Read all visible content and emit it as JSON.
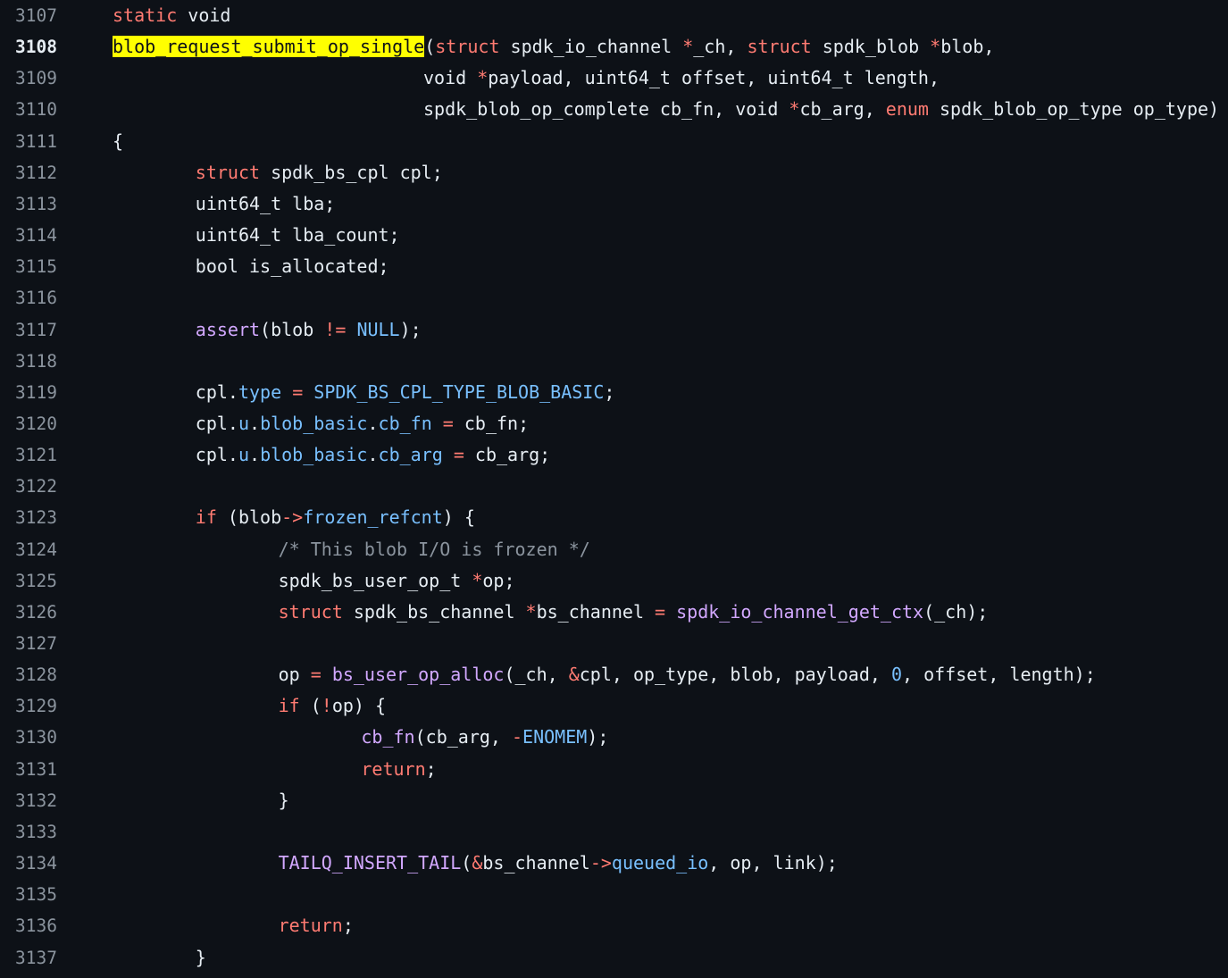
{
  "code_view": {
    "current_line": 3108,
    "colors": {
      "background": "#0d1117",
      "text": "#e6edf3",
      "keyword": "#ff7b72",
      "function": "#d2a8ff",
      "constant": "#79c0ff",
      "comment": "#8b949e",
      "line_number": "#8b949e",
      "highlight": "#ffff00"
    },
    "lines": [
      {
        "n": "3107",
        "indent": 0,
        "tokens": [
          [
            "k",
            "static"
          ],
          [
            "t",
            " void"
          ]
        ]
      },
      {
        "n": "3108",
        "indent": 0,
        "tokens": [
          [
            "h",
            "blob_request_submit_op_single"
          ],
          [
            "t",
            "("
          ],
          [
            "k",
            "struct"
          ],
          [
            "t",
            " spdk_io_channel "
          ],
          [
            "k",
            "*"
          ],
          [
            "t",
            "_ch, "
          ],
          [
            "k",
            "struct"
          ],
          [
            "t",
            " spdk_blob "
          ],
          [
            "k",
            "*"
          ],
          [
            "t",
            "blob,"
          ]
        ]
      },
      {
        "n": "3109",
        "indent": 30,
        "tokens": [
          [
            "t",
            "void "
          ],
          [
            "k",
            "*"
          ],
          [
            "t",
            "payload, uint64_t offset, uint64_t length,"
          ]
        ]
      },
      {
        "n": "3110",
        "indent": 30,
        "tokens": [
          [
            "t",
            "spdk_blob_op_complete cb_fn, void "
          ],
          [
            "k",
            "*"
          ],
          [
            "t",
            "cb_arg, "
          ],
          [
            "k",
            "enum"
          ],
          [
            "t",
            " spdk_blob_op_type op_type)"
          ]
        ]
      },
      {
        "n": "3111",
        "indent": 0,
        "tokens": [
          [
            "t",
            "{"
          ]
        ]
      },
      {
        "n": "3112",
        "indent": 8,
        "tokens": [
          [
            "k",
            "struct"
          ],
          [
            "t",
            " spdk_bs_cpl cpl;"
          ]
        ]
      },
      {
        "n": "3113",
        "indent": 8,
        "tokens": [
          [
            "t",
            "uint64_t lba;"
          ]
        ]
      },
      {
        "n": "3114",
        "indent": 8,
        "tokens": [
          [
            "t",
            "uint64_t lba_count;"
          ]
        ]
      },
      {
        "n": "3115",
        "indent": 8,
        "tokens": [
          [
            "t",
            "bool is_allocated;"
          ]
        ]
      },
      {
        "n": "3116",
        "indent": 0,
        "tokens": []
      },
      {
        "n": "3117",
        "indent": 8,
        "tokens": [
          [
            "f",
            "assert"
          ],
          [
            "t",
            "(blob "
          ],
          [
            "k",
            "!="
          ],
          [
            "t",
            " "
          ],
          [
            "p",
            "NULL"
          ],
          [
            "t",
            ");"
          ]
        ]
      },
      {
        "n": "3118",
        "indent": 0,
        "tokens": []
      },
      {
        "n": "3119",
        "indent": 8,
        "tokens": [
          [
            "t",
            "cpl."
          ],
          [
            "p",
            "type"
          ],
          [
            "t",
            " "
          ],
          [
            "k",
            "="
          ],
          [
            "t",
            " "
          ],
          [
            "p",
            "SPDK_BS_CPL_TYPE_BLOB_BASIC"
          ],
          [
            "t",
            ";"
          ]
        ]
      },
      {
        "n": "3120",
        "indent": 8,
        "tokens": [
          [
            "t",
            "cpl."
          ],
          [
            "p",
            "u"
          ],
          [
            "t",
            "."
          ],
          [
            "p",
            "blob_basic"
          ],
          [
            "t",
            "."
          ],
          [
            "p",
            "cb_fn"
          ],
          [
            "t",
            " "
          ],
          [
            "k",
            "="
          ],
          [
            "t",
            " cb_fn;"
          ]
        ]
      },
      {
        "n": "3121",
        "indent": 8,
        "tokens": [
          [
            "t",
            "cpl."
          ],
          [
            "p",
            "u"
          ],
          [
            "t",
            "."
          ],
          [
            "p",
            "blob_basic"
          ],
          [
            "t",
            "."
          ],
          [
            "p",
            "cb_arg"
          ],
          [
            "t",
            " "
          ],
          [
            "k",
            "="
          ],
          [
            "t",
            " cb_arg;"
          ]
        ]
      },
      {
        "n": "3122",
        "indent": 0,
        "tokens": []
      },
      {
        "n": "3123",
        "indent": 8,
        "tokens": [
          [
            "k",
            "if"
          ],
          [
            "t",
            " (blob"
          ],
          [
            "k",
            "->"
          ],
          [
            "p",
            "frozen_refcnt"
          ],
          [
            "t",
            ") {"
          ]
        ]
      },
      {
        "n": "3124",
        "indent": 16,
        "tokens": [
          [
            "c",
            "/* This blob I/O is frozen */"
          ]
        ]
      },
      {
        "n": "3125",
        "indent": 16,
        "tokens": [
          [
            "t",
            "spdk_bs_user_op_t "
          ],
          [
            "k",
            "*"
          ],
          [
            "t",
            "op;"
          ]
        ]
      },
      {
        "n": "3126",
        "indent": 16,
        "tokens": [
          [
            "k",
            "struct"
          ],
          [
            "t",
            " spdk_bs_channel "
          ],
          [
            "k",
            "*"
          ],
          [
            "t",
            "bs_channel "
          ],
          [
            "k",
            "="
          ],
          [
            "t",
            " "
          ],
          [
            "f",
            "spdk_io_channel_get_ctx"
          ],
          [
            "t",
            "(_ch);"
          ]
        ]
      },
      {
        "n": "3127",
        "indent": 0,
        "tokens": []
      },
      {
        "n": "3128",
        "indent": 16,
        "tokens": [
          [
            "t",
            "op "
          ],
          [
            "k",
            "="
          ],
          [
            "t",
            " "
          ],
          [
            "f",
            "bs_user_op_alloc"
          ],
          [
            "t",
            "(_ch, "
          ],
          [
            "k",
            "&"
          ],
          [
            "t",
            "cpl, op_type, blob, payload, "
          ],
          [
            "p",
            "0"
          ],
          [
            "t",
            ", offset, length);"
          ]
        ]
      },
      {
        "n": "3129",
        "indent": 16,
        "tokens": [
          [
            "k",
            "if"
          ],
          [
            "t",
            " ("
          ],
          [
            "k",
            "!"
          ],
          [
            "t",
            "op) {"
          ]
        ]
      },
      {
        "n": "3130",
        "indent": 24,
        "tokens": [
          [
            "f",
            "cb_fn"
          ],
          [
            "t",
            "(cb_arg, "
          ],
          [
            "k",
            "-"
          ],
          [
            "p",
            "ENOMEM"
          ],
          [
            "t",
            ");"
          ]
        ]
      },
      {
        "n": "3131",
        "indent": 24,
        "tokens": [
          [
            "k",
            "return"
          ],
          [
            "t",
            ";"
          ]
        ]
      },
      {
        "n": "3132",
        "indent": 16,
        "tokens": [
          [
            "t",
            "}"
          ]
        ]
      },
      {
        "n": "3133",
        "indent": 0,
        "tokens": []
      },
      {
        "n": "3134",
        "indent": 16,
        "tokens": [
          [
            "f",
            "TAILQ_INSERT_TAIL"
          ],
          [
            "t",
            "("
          ],
          [
            "k",
            "&"
          ],
          [
            "t",
            "bs_channel"
          ],
          [
            "k",
            "->"
          ],
          [
            "p",
            "queued_io"
          ],
          [
            "t",
            ", op, link);"
          ]
        ]
      },
      {
        "n": "3135",
        "indent": 0,
        "tokens": []
      },
      {
        "n": "3136",
        "indent": 16,
        "tokens": [
          [
            "k",
            "return"
          ],
          [
            "t",
            ";"
          ]
        ]
      },
      {
        "n": "3137",
        "indent": 8,
        "tokens": [
          [
            "t",
            "}"
          ]
        ]
      }
    ]
  }
}
